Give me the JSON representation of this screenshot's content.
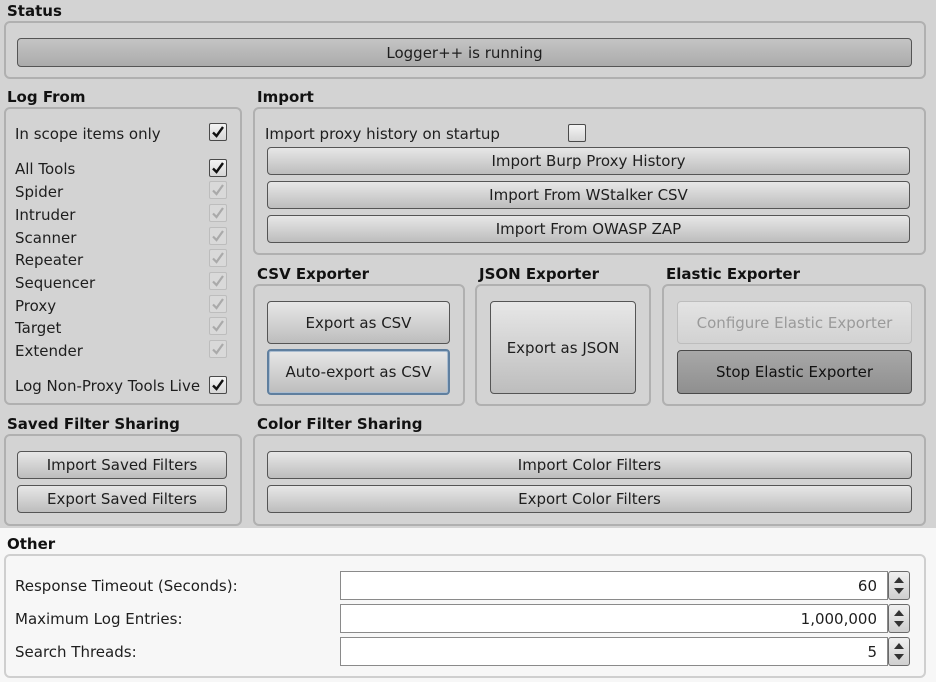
{
  "status": {
    "title": "Status",
    "text": "Logger++ is running"
  },
  "log_from": {
    "title": "Log From",
    "in_scope_label": "In scope items only",
    "in_scope_checked": true,
    "all_tools_label": "All Tools",
    "all_tools_checked": true,
    "tools": [
      "Spider",
      "Intruder",
      "Scanner",
      "Repeater",
      "Sequencer",
      "Proxy",
      "Target",
      "Extender"
    ],
    "non_proxy_label": "Log Non-Proxy Tools Live",
    "non_proxy_checked": true
  },
  "import": {
    "title": "Import",
    "proxy_history_label": "Import proxy history on startup",
    "proxy_history_checked": false,
    "burp_button": "Import Burp Proxy History",
    "wstalker_button": "Import From WStalker CSV",
    "zap_button": "Import From OWASP ZAP"
  },
  "csv_exporter": {
    "title": "CSV Exporter",
    "export_button": "Export as CSV",
    "auto_export_button": "Auto-export as CSV"
  },
  "json_exporter": {
    "title": "JSON Exporter",
    "export_button": "Export as JSON"
  },
  "elastic_exporter": {
    "title": "Elastic Exporter",
    "configure_button": "Configure Elastic Exporter",
    "stop_button": "Stop Elastic Exporter"
  },
  "saved_filters": {
    "title": "Saved Filter Sharing",
    "import_button": "Import Saved Filters",
    "export_button": "Export Saved Filters"
  },
  "color_filters": {
    "title": "Color Filter Sharing",
    "import_button": "Import Color Filters",
    "export_button": "Export Color Filters"
  },
  "other": {
    "title": "Other",
    "response_timeout_label": "Response Timeout (Seconds):",
    "response_timeout_value": "60",
    "max_entries_label": "Maximum Log Entries:",
    "max_entries_value": "1,000,000",
    "search_threads_label": "Search Threads:",
    "search_threads_value": "5"
  }
}
